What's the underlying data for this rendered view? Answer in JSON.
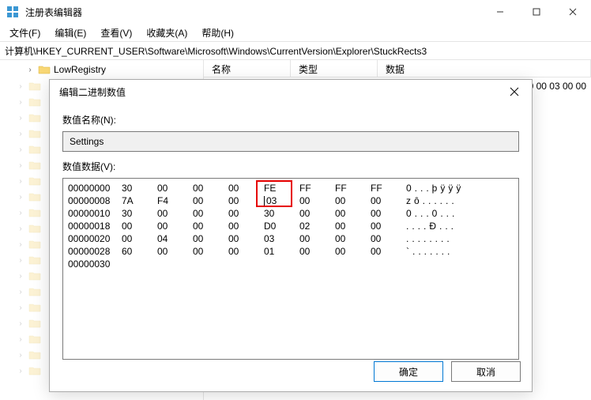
{
  "window": {
    "title": "注册表编辑器",
    "min": "–",
    "max": "□",
    "close": "×"
  },
  "menu": {
    "file": "文件(F)",
    "edit": "编辑(E)",
    "view": "查看(V)",
    "fav": "收藏夹(A)",
    "help": "帮助(H)"
  },
  "address": "计算机\\HKEY_CURRENT_USER\\Software\\Microsoft\\Windows\\CurrentVersion\\Explorer\\StuckRects3",
  "tree": {
    "item1": "LowRegistry"
  },
  "list": {
    "col_name": "名称",
    "col_type": "类型",
    "col_data": "数据",
    "row1_data_tail": "00 00 03 00 00"
  },
  "dialog": {
    "title": "编辑二进制数值",
    "label_name": "数值名称(N):",
    "value_name": "Settings",
    "label_data": "数值数据(V):",
    "ok": "确定",
    "cancel": "取消"
  },
  "hex": {
    "rows": [
      {
        "off": "00000000",
        "b": [
          "30",
          "00",
          "00",
          "00",
          "FE",
          "FF",
          "FF",
          "FF"
        ],
        "a": "0...þÿÿÿ"
      },
      {
        "off": "00000008",
        "b": [
          "7A",
          "F4",
          "00",
          "00",
          "03",
          "00",
          "00",
          "00"
        ],
        "a": "zô......"
      },
      {
        "off": "00000010",
        "b": [
          "30",
          "00",
          "00",
          "00",
          "30",
          "00",
          "00",
          "00"
        ],
        "a": "0...0..."
      },
      {
        "off": "00000018",
        "b": [
          "00",
          "00",
          "00",
          "00",
          "D0",
          "02",
          "00",
          "00"
        ],
        "a": "....Ð..."
      },
      {
        "off": "00000020",
        "b": [
          "00",
          "04",
          "00",
          "00",
          "03",
          "00",
          "00",
          "00"
        ],
        "a": "........"
      },
      {
        "off": "00000028",
        "b": [
          "60",
          "00",
          "00",
          "00",
          "01",
          "00",
          "00",
          "00"
        ],
        "a": "`......."
      },
      {
        "off": "00000030",
        "b": [
          "",
          "",
          "",
          "",
          "",
          "",
          "",
          ""
        ],
        "a": ""
      }
    ]
  }
}
